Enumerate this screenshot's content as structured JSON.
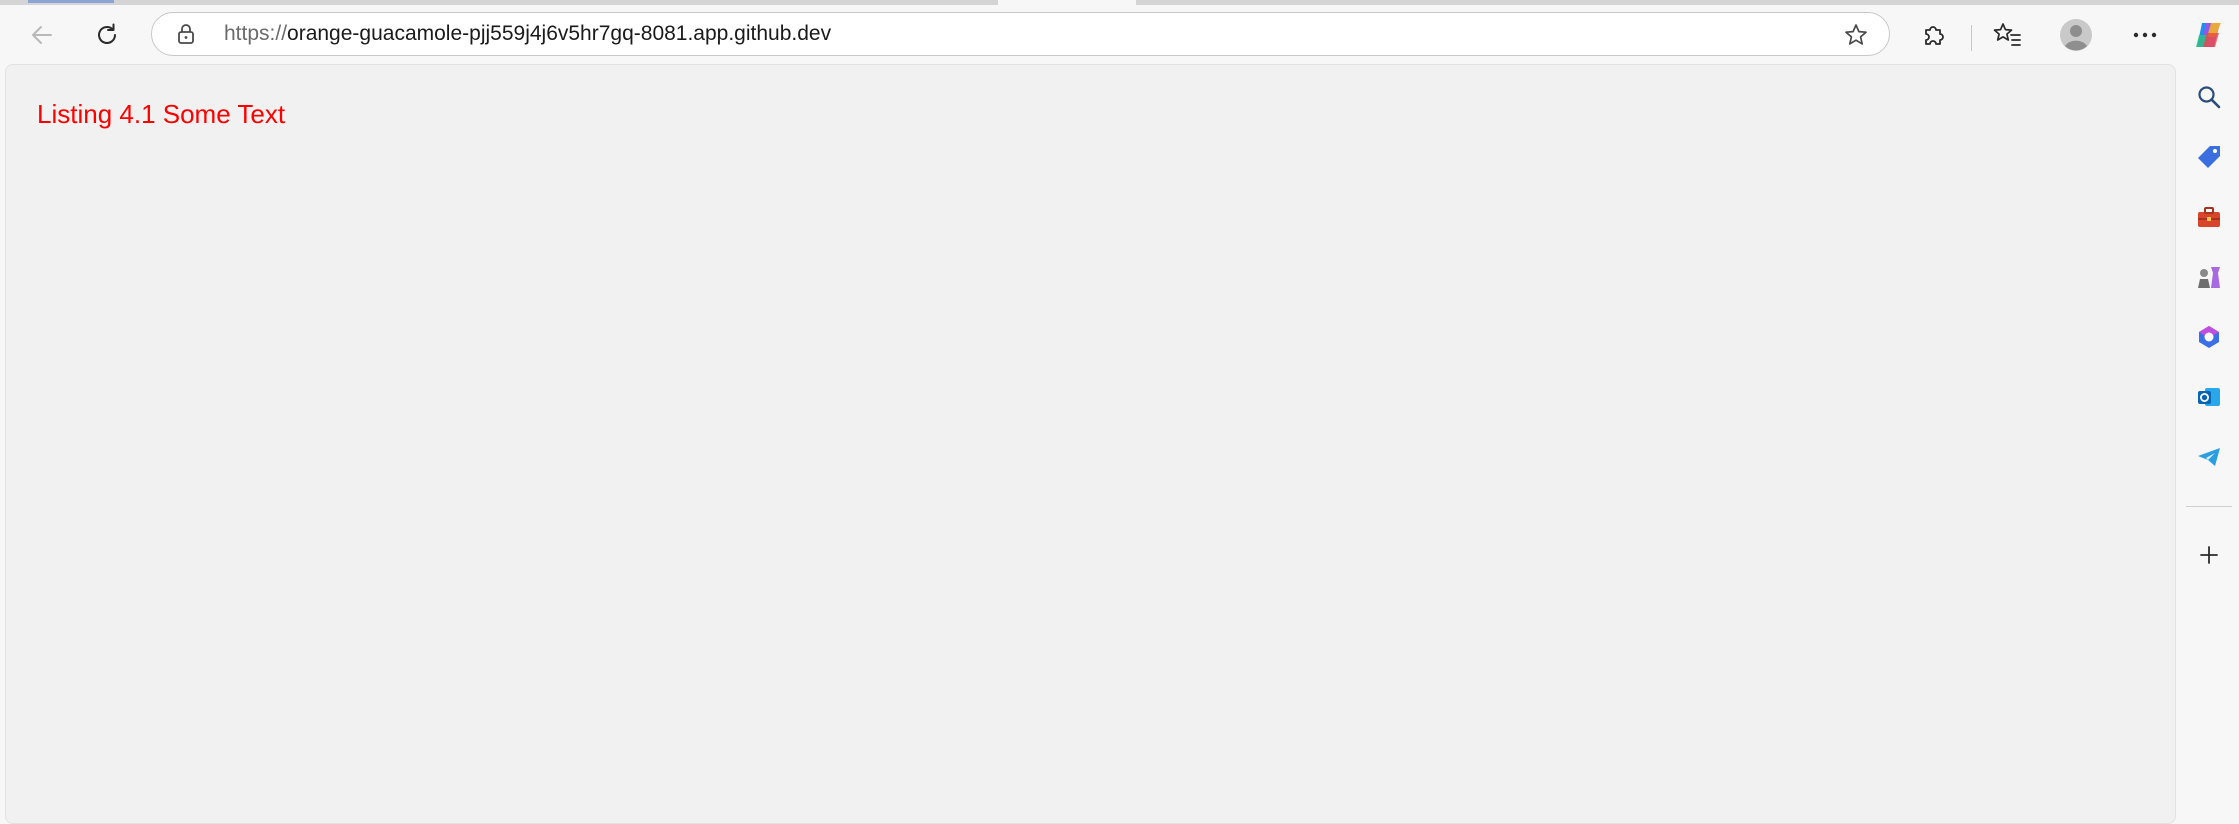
{
  "browser": {
    "url_scheme": "https://",
    "url_host": "orange-guacamole-pjj559j4j6v5hr7gq-8081.app.github.dev",
    "toolbar_icons": [
      "back-icon",
      "refresh-icon",
      "lock-icon",
      "favorite-star-icon",
      "extensions-icon",
      "favorites-icon",
      "profile-icon",
      "more-icon",
      "copilot-icon"
    ],
    "sidebar_icons": [
      "search-icon",
      "shopping-tag-icon",
      "tools-icon",
      "games-icon",
      "microsoft-365-icon",
      "outlook-icon",
      "telegram-icon",
      "add-icon"
    ]
  },
  "page": {
    "heading": "Listing 4.1 Some Text",
    "heading_color": "#ff0000",
    "background": "#f1f1f1"
  }
}
